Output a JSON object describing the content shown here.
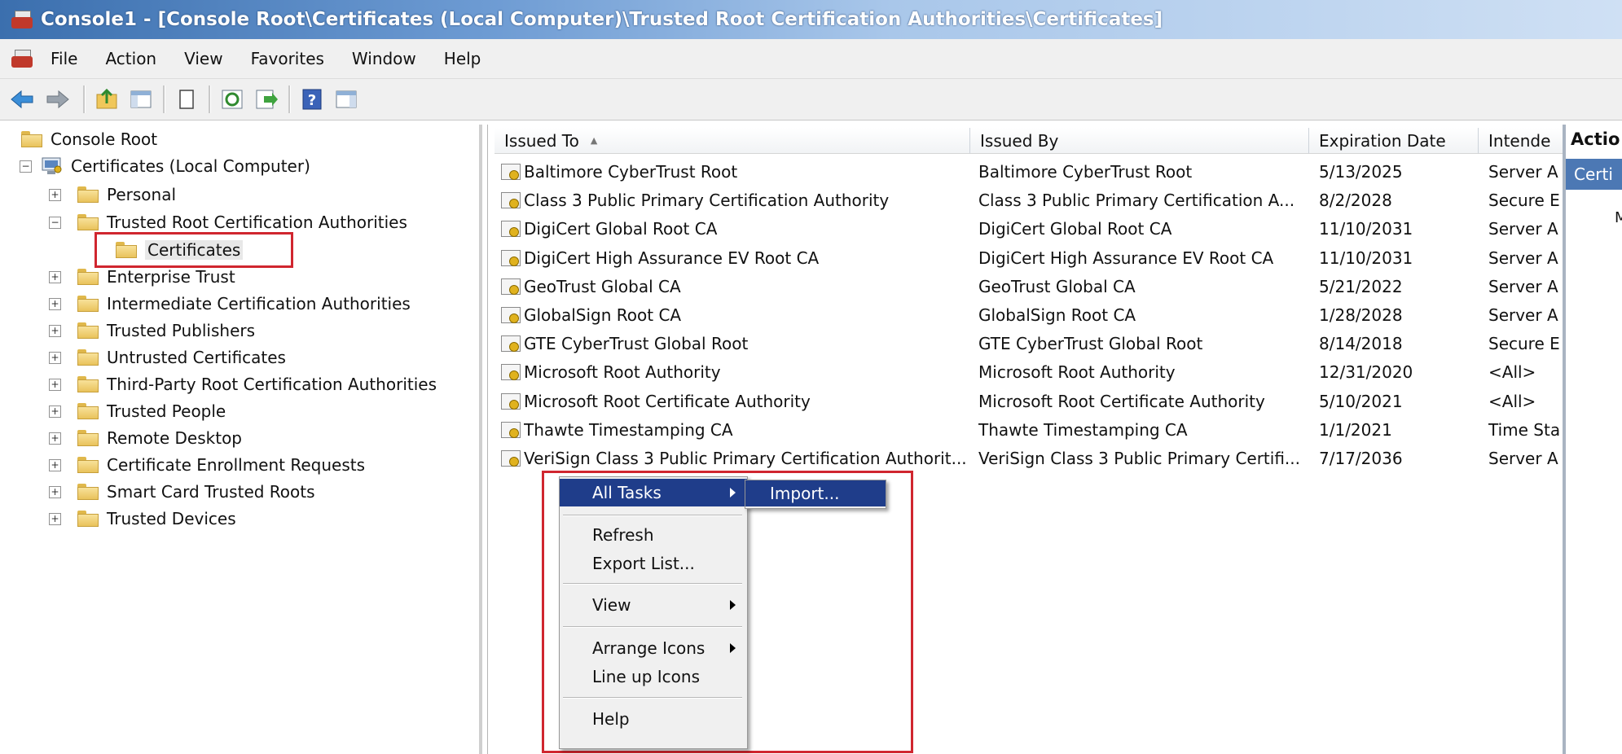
{
  "window": {
    "title": "Console1 - [Console Root\\Certificates (Local Computer)\\Trusted Root Certification Authorities\\Certificates]"
  },
  "menu": [
    "File",
    "Action",
    "View",
    "Favorites",
    "Window",
    "Help"
  ],
  "toolbar": {
    "icons": [
      "back-arrow-icon",
      "forward-arrow-icon",
      "up-folder-icon",
      "show-hide-tree-icon",
      "copy-icon",
      "refresh-icon",
      "export-list-icon",
      "help-icon",
      "show-hide-action-pane-icon"
    ]
  },
  "tree": {
    "root": "Console Root",
    "computer": "Certificates (Local Computer)",
    "items": [
      {
        "label": "Personal",
        "expander": "+"
      },
      {
        "label": "Trusted Root Certification Authorities",
        "expander": "−"
      },
      {
        "label": "Certificates",
        "expander": ""
      },
      {
        "label": "Enterprise Trust",
        "expander": "+"
      },
      {
        "label": "Intermediate Certification Authorities",
        "expander": "+"
      },
      {
        "label": "Trusted Publishers",
        "expander": "+"
      },
      {
        "label": "Untrusted Certificates",
        "expander": "+"
      },
      {
        "label": "Third-Party Root Certification Authorities",
        "expander": "+"
      },
      {
        "label": "Trusted People",
        "expander": "+"
      },
      {
        "label": "Remote Desktop",
        "expander": "+"
      },
      {
        "label": "Certificate Enrollment Requests",
        "expander": "+"
      },
      {
        "label": "Smart Card Trusted Roots",
        "expander": "+"
      },
      {
        "label": "Trusted Devices",
        "expander": "+"
      }
    ],
    "computer_expander": "−"
  },
  "list": {
    "columns": [
      "Issued To",
      "Issued By",
      "Expiration Date",
      "Intende"
    ],
    "sort_indicator": "▲",
    "rows": [
      [
        "Baltimore CyberTrust Root",
        "Baltimore CyberTrust Root",
        "5/13/2025",
        "Server A"
      ],
      [
        "Class 3 Public Primary Certification Authority",
        "Class 3 Public Primary Certification A...",
        "8/2/2028",
        "Secure E"
      ],
      [
        "DigiCert Global Root CA",
        "DigiCert Global Root CA",
        "11/10/2031",
        "Server A"
      ],
      [
        "DigiCert High Assurance EV Root CA",
        "DigiCert High Assurance EV Root CA",
        "11/10/2031",
        "Server A"
      ],
      [
        "GeoTrust Global CA",
        "GeoTrust Global CA",
        "5/21/2022",
        "Server A"
      ],
      [
        "GlobalSign Root CA",
        "GlobalSign Root CA",
        "1/28/2028",
        "Server A"
      ],
      [
        "GTE CyberTrust Global Root",
        "GTE CyberTrust Global Root",
        "8/14/2018",
        "Secure E"
      ],
      [
        "Microsoft Root Authority",
        "Microsoft Root Authority",
        "12/31/2020",
        "<All>"
      ],
      [
        "Microsoft Root Certificate Authority",
        "Microsoft Root Certificate Authority",
        "5/10/2021",
        "<All>"
      ],
      [
        "Thawte Timestamping CA",
        "Thawte Timestamping CA",
        "1/1/2021",
        "Time Sta"
      ],
      [
        "VeriSign Class 3 Public Primary Certification Authorit...",
        "VeriSign Class 3 Public Primary Certifi...",
        "7/17/2036",
        "Server A"
      ]
    ]
  },
  "context_menu": {
    "items": [
      "All Tasks",
      "Refresh",
      "Export List...",
      "View",
      "Arrange Icons",
      "Line up Icons",
      "Help"
    ],
    "submenu": [
      "Import..."
    ]
  },
  "actions": {
    "header": "Actio",
    "selected": "Certi",
    "more": "M"
  },
  "colors": {
    "selection": "#1f3d8a",
    "highlight_box": "#d0262f",
    "actions_selected": "#4c78b4"
  }
}
